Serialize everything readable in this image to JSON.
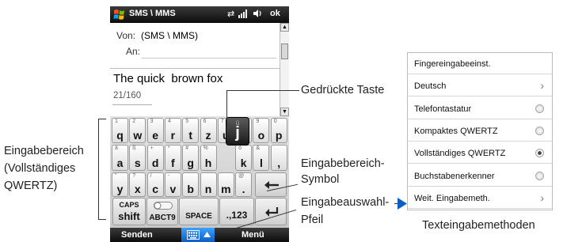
{
  "phone": {
    "title": "SMS \\ MMS",
    "status_ok": "ok",
    "from_label": "Von:",
    "from_value": "(SMS \\ MMS)",
    "to_label": "An:",
    "message_text": "The quick  brown fox",
    "char_counter": "21/160",
    "keyboard": {
      "row1": [
        {
          "sec": "1",
          "pri": "q"
        },
        {
          "sec": "2",
          "pri": "w"
        },
        {
          "sec": "3",
          "pri": "e"
        },
        {
          "sec": "4",
          "pri": "r"
        },
        {
          "sec": "5",
          "pri": "t"
        },
        {
          "sec": "6",
          "pri": "z"
        },
        {
          "sec": "7",
          "pri": "u"
        },
        {
          "sec": "8",
          "pri": "i"
        },
        {
          "sec": "9",
          "pri": "o"
        },
        {
          "sec": "0",
          "pri": "p"
        }
      ],
      "row2": [
        {
          "sec": "ä",
          "pri": "a"
        },
        {
          "sec": "ß",
          "pri": "s"
        },
        {
          "sec": "+",
          "pri": "d"
        },
        {
          "sec": "*",
          "pri": "f"
        },
        {
          "sec": "#",
          "pri": "g"
        },
        {
          "sec": "%",
          "pri": "h"
        },
        {
          "sec": "ö",
          "pri": "k"
        },
        {
          "sec": "&",
          "pri": "l"
        },
        {
          "sec": "",
          "pri": ","
        }
      ],
      "row3": [
        {
          "sec": "\"",
          "pri": "y"
        },
        {
          "sec": "?",
          "pri": "x"
        },
        {
          "sec": "/",
          "pri": "c"
        },
        {
          "sec": "-",
          "pri": "v"
        },
        {
          "sec": "",
          "pri": "b"
        },
        {
          "sec": "",
          "pri": "n"
        },
        {
          "sec": "",
          "pri": "m"
        },
        {
          "sec": "@",
          "pri": "."
        }
      ],
      "pressed_key": {
        "sec": "ü",
        "pri": "j"
      },
      "caps_label": "CAPS",
      "shift_label": "shift",
      "abc_label": "ABCT9",
      "space_label": "SPACE",
      "num_label": ".,123"
    },
    "softkey_left": "Senden",
    "softkey_right": "Menü"
  },
  "annotations": {
    "pressed_key": "Gedrückte Taste",
    "input_area_line1": "Eingabebereich",
    "input_area_line2": "(Vollständiges",
    "input_area_line3": "QWERTZ)",
    "input_icon_line1": "Eingabebereich-",
    "input_icon_line2": "Symbol",
    "input_arrow_line1": "Eingabeauswahl-",
    "input_arrow_line2": "Pfeil"
  },
  "menu": {
    "items": [
      {
        "label": "Fingereingabeeinst.",
        "control": "none"
      },
      {
        "label": "Deutsch",
        "control": "chevron"
      },
      {
        "label": "Telefontastatur",
        "control": "radio"
      },
      {
        "label": "Kompaktes QWERTZ",
        "control": "radio"
      },
      {
        "label": "Vollständiges QWERTZ",
        "control": "radio-selected"
      },
      {
        "label": "Buchstabenerkenner",
        "control": "radio"
      },
      {
        "label": "Weit. Eingabemeth.",
        "control": "chevron"
      }
    ],
    "caption": "Texteingabemethoden"
  }
}
